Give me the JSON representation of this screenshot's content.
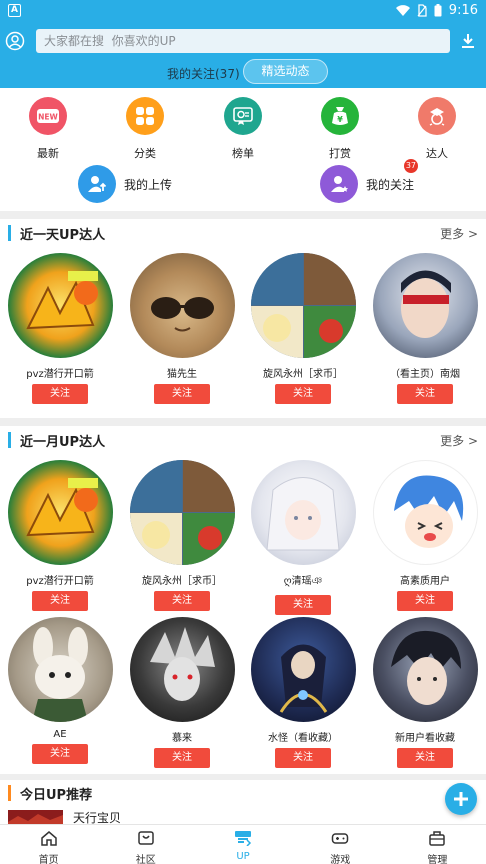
{
  "status_bar": {
    "left_icon": "A",
    "time": "9:16"
  },
  "header": {
    "search_placeholder": "大家都在搜  你喜欢的UP",
    "follow_count": "我的关注(37)",
    "featured_button": "精选动态"
  },
  "categories": [
    {
      "label": "最新",
      "icon": "new-icon",
      "color": "#f05466"
    },
    {
      "label": "分类",
      "icon": "grid-icon",
      "color": "#ff9f1a"
    },
    {
      "label": "榜单",
      "icon": "ranking-icon",
      "color": "#1fa68f"
    },
    {
      "label": "打赏",
      "icon": "reward-icon",
      "color": "#25b43a"
    },
    {
      "label": "达人",
      "icon": "expert-icon",
      "color": "#f07a6a"
    }
  ],
  "quick_links": [
    {
      "label": "我的上传",
      "icon": "upload-user-icon",
      "color": "#2f9be8"
    },
    {
      "label": "我的关注",
      "icon": "follow-user-icon",
      "color": "#8e5ad8",
      "badge": "37"
    }
  ],
  "sections": {
    "day": {
      "title": "近一天UP达人",
      "more": "更多 >"
    },
    "month": {
      "title": "近一月UP达人",
      "more": "更多 >"
    },
    "today": {
      "title": "今日UP推荐"
    }
  },
  "follow_label": "关注",
  "day_ups": [
    {
      "name": "pvz潜行开口箭"
    },
    {
      "name": "猫先生"
    },
    {
      "name": "旋风永州［求币］"
    },
    {
      "name": "（看主页）南烟"
    }
  ],
  "month_ups_row1": [
    {
      "name": "pvz潜行开口箭"
    },
    {
      "name": "旋风永州［求币］"
    },
    {
      "name": "ღ清瑶ঞ"
    },
    {
      "name": "高素质用户"
    }
  ],
  "month_ups_row2": [
    {
      "name": "AE"
    },
    {
      "name": "慕来"
    },
    {
      "name": "水怪（看收藏）"
    },
    {
      "name": "新用户看收藏"
    }
  ],
  "today_rec": {
    "name": "天行宝贝"
  },
  "bottom_nav": [
    {
      "label": "首页",
      "icon": "home-icon"
    },
    {
      "label": "社区",
      "icon": "community-icon"
    },
    {
      "label": "UP",
      "icon": "up-icon",
      "active": true
    },
    {
      "label": "游戏",
      "icon": "gamepad-icon"
    },
    {
      "label": "管理",
      "icon": "manage-icon"
    }
  ]
}
